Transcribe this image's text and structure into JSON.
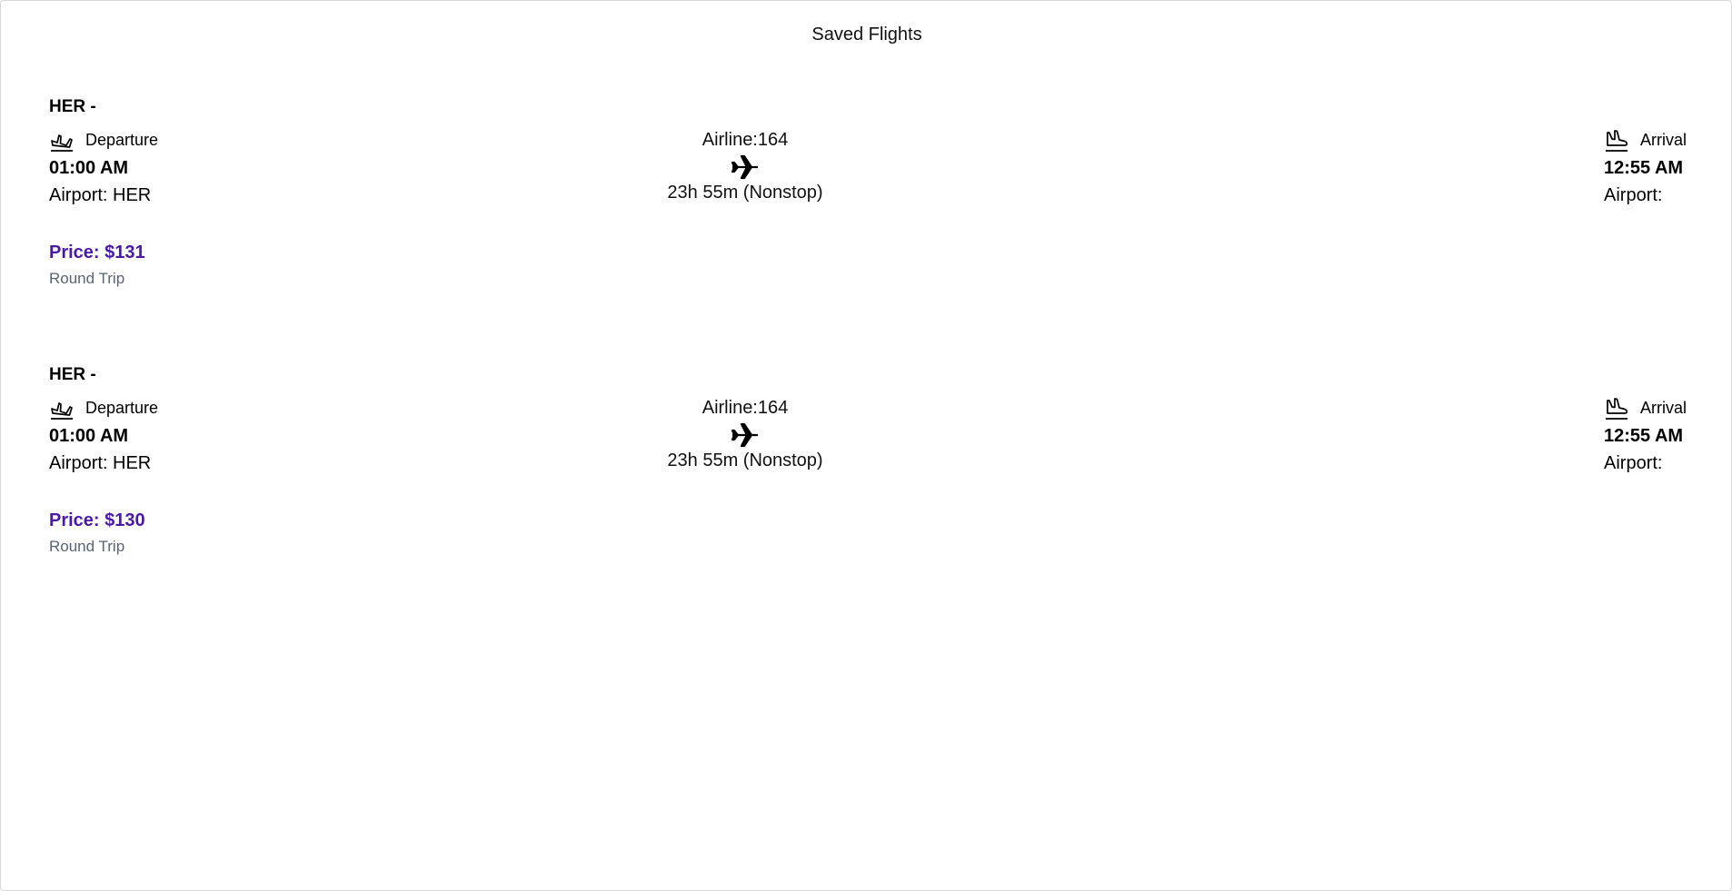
{
  "page": {
    "title": "Saved Flights"
  },
  "colors": {
    "price": "#4a1aa6",
    "trip_type": "#5a6472"
  },
  "flights": [
    {
      "route": "HER -",
      "departure": {
        "label": "Departure",
        "icon": "takeoff-icon",
        "time": "01:00 AM",
        "airport": "Airport: HER"
      },
      "airline": "Airline:164",
      "duration": "23h 55m (Nonstop)",
      "arrival": {
        "label": "Arrival",
        "icon": "landing-icon",
        "time": "12:55 AM",
        "airport": "Airport:"
      },
      "price": "Price: $131",
      "trip_type": "Round Trip"
    },
    {
      "route": "HER -",
      "departure": {
        "label": "Departure",
        "icon": "takeoff-icon",
        "time": "01:00 AM",
        "airport": "Airport: HER"
      },
      "airline": "Airline:164",
      "duration": "23h 55m (Nonstop)",
      "arrival": {
        "label": "Arrival",
        "icon": "landing-icon",
        "time": "12:55 AM",
        "airport": "Airport:"
      },
      "price": "Price: $130",
      "trip_type": "Round Trip"
    }
  ]
}
